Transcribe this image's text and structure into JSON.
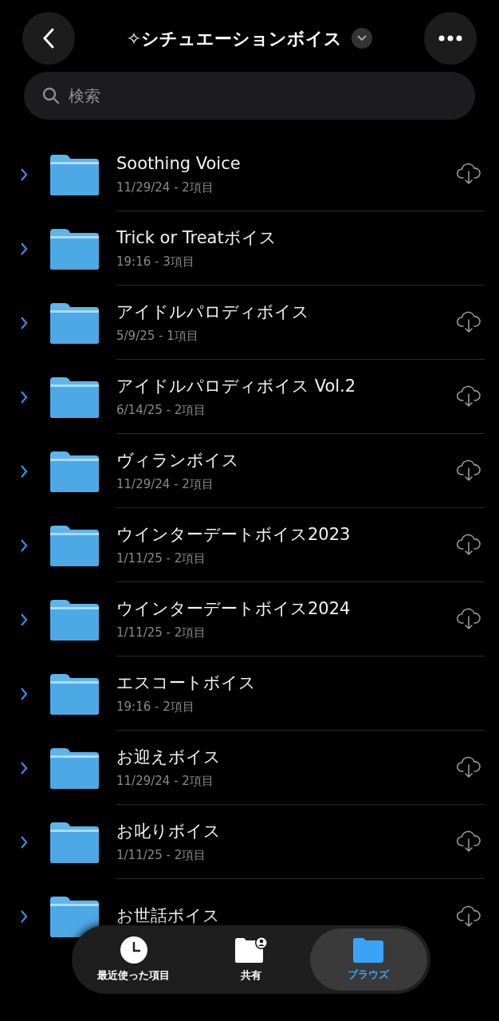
{
  "header": {
    "title": "✧シチュエーションボイス"
  },
  "search": {
    "placeholder": "検索"
  },
  "folders": [
    {
      "name": "Soothing Voice",
      "meta": "11/29/24 - 2項目",
      "downloadable": true
    },
    {
      "name": "Trick or Treatボイス",
      "meta": "19:16 - 3項目",
      "downloadable": false
    },
    {
      "name": "アイドルパロディボイス",
      "meta": "5/9/25 - 1項目",
      "downloadable": true
    },
    {
      "name": "アイドルパロディボイス Vol.2",
      "meta": "6/14/25 - 2項目",
      "downloadable": true
    },
    {
      "name": "ヴィランボイス",
      "meta": "11/29/24 - 2項目",
      "downloadable": true
    },
    {
      "name": "ウインターデートボイス2023",
      "meta": "1/11/25 - 2項目",
      "downloadable": true
    },
    {
      "name": "ウインターデートボイス2024",
      "meta": "1/11/25 - 2項目",
      "downloadable": true
    },
    {
      "name": "エスコートボイス",
      "meta": "19:16 - 2項目",
      "downloadable": false
    },
    {
      "name": "お迎えボイス",
      "meta": "11/29/24 - 2項目",
      "downloadable": true
    },
    {
      "name": "お叱りボイス",
      "meta": "1/11/25 - 2項目",
      "downloadable": true
    },
    {
      "name": "お世話ボイス",
      "downloadable": true
    }
  ],
  "tab_bar": [
    {
      "label": "最近使った項目",
      "kind": "recent",
      "selected": false
    },
    {
      "label": "共有",
      "kind": "shared",
      "selected": false
    },
    {
      "label": "ブラウズ",
      "kind": "browse",
      "selected": true
    }
  ]
}
